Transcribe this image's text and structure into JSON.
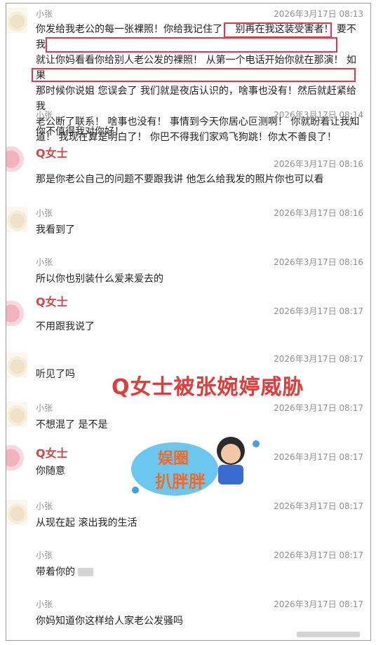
{
  "messages": [
    {
      "sender": "小张",
      "time": "2026年3月17日 08:13",
      "avatar": "sheep-avatar",
      "lines": [
        "你发给我老公的每一张裸照！你给我记住了！ 别再在我这装受害者！ 要不我",
        "就让你妈看看你给别人老公发的裸照！ 从第一个电话开始你就在那演！ 如果",
        "那时候你说姐 您误会了 我们就是夜店认识的，啥事也没有！然后就赶紧给我",
        "老公断了联系！ 啥事也没有！ 事情到今天你居心叵测啊！ 你就盼着让我知",
        "道！ 我现在算是明白了！ 你巴不得我们家鸡飞狗跳！你太不善良了！"
      ]
    },
    {
      "sender": "小张",
      "time": "2026年3月17日 08:14",
      "avatar": "sheep-avatar",
      "lines": [
        "你不值得我对你好！"
      ]
    },
    {
      "sender": "Q女士",
      "time": "2026年3月17日 08:16",
      "avatar": "pink-avatar",
      "lines": [
        "那是你老公自己的问题不要跟我讲 他怎么给我发的照片你也可以看"
      ]
    },
    {
      "sender": "小张",
      "time": "2026年3月17日 08:16",
      "avatar": "sheep-avatar",
      "lines": [
        "我看到了"
      ]
    },
    {
      "sender": "小张",
      "time": "2026年3月17日 08:16",
      "avatar": "none",
      "lines": [
        "所以你也别装什么爱来爱去的"
      ]
    },
    {
      "sender": "Q女士",
      "time": "2026年3月17日 08:17",
      "avatar": "pink-avatar",
      "lines": [
        "不用跟我说了"
      ]
    },
    {
      "sender": "",
      "time": "2026年3月17日 08:17",
      "avatar": "sheep-avatar",
      "lines": [
        "听见了吗"
      ]
    },
    {
      "sender": "小张",
      "time": "2026年3月17日 08:17",
      "avatar": "sheep-avatar",
      "lines": [
        "不想混了 是不是"
      ]
    },
    {
      "sender": "Q女士",
      "time": "2026年3月17日 08:17",
      "avatar": "pink-avatar",
      "lines": [
        "你随意"
      ]
    },
    {
      "sender": "小张",
      "time": "2026年3月17日 08:17",
      "avatar": "sheep-avatar",
      "lines": [
        "从现在起 滚出我的生活"
      ]
    },
    {
      "sender": "小张",
      "time": "2026年3月17日 08:17",
      "avatar": "none",
      "lines": [
        "带着你的"
      ]
    },
    {
      "sender": "小张",
      "time": "2026年3月17日 08:17",
      "avatar": "none",
      "lines": [
        "你妈知道你这样给人家老公发骚吗"
      ]
    }
  ],
  "caption": "Q女士被张婉婷威胁",
  "logo_text": "娱圈扒胖胖",
  "colors": {
    "accent_red": "#e23b3b",
    "highlight_box": "#e0374a",
    "meta_gray": "#8f8f8f"
  }
}
